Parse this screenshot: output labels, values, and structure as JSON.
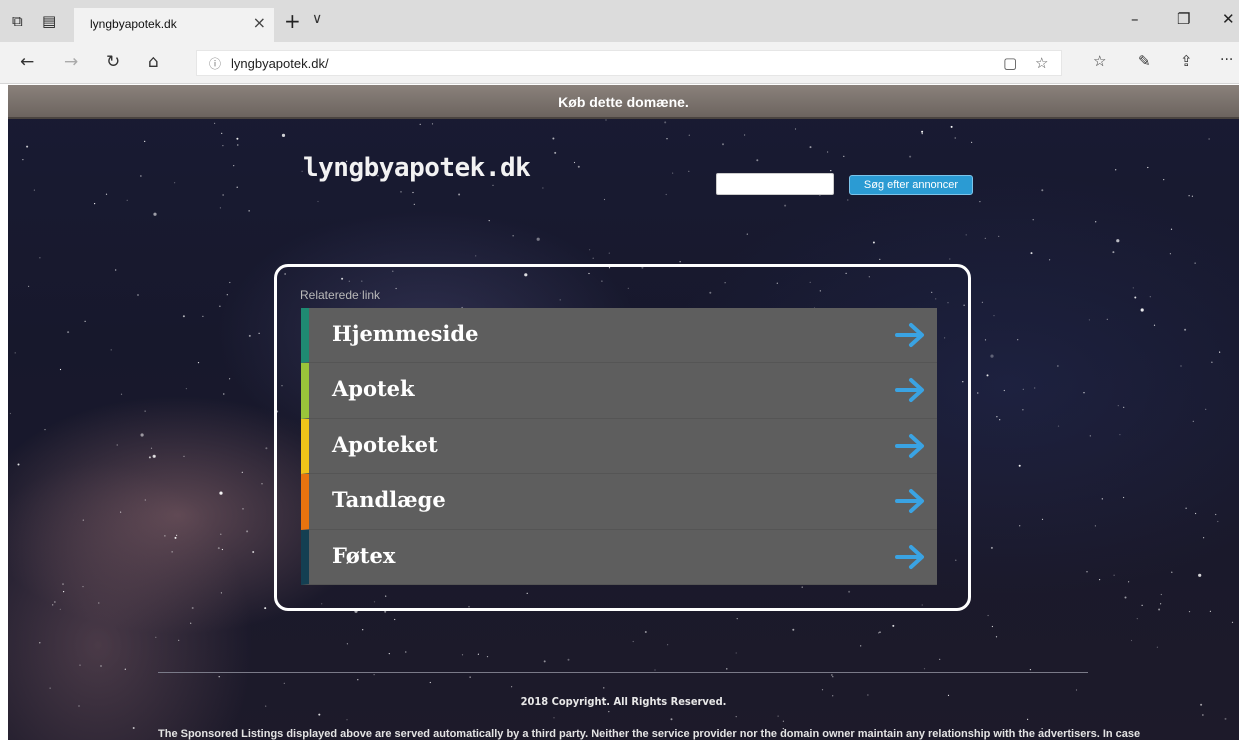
{
  "browser": {
    "tab_title": "lyngbyapotek.dk",
    "tab_close": "×",
    "new_tab": "+",
    "tab_menu": "∨",
    "url": "lyngbyapotek.dk/",
    "window_controls": {
      "minimize": "–",
      "restore": "❐",
      "close": "✕"
    },
    "nav": {
      "back": "←",
      "forward": "→",
      "refresh": "↻",
      "home": "⌂"
    },
    "address_icons": {
      "reading_view": "▢",
      "favorite": "☆"
    },
    "toolbar_icons": {
      "favorites": "☆",
      "notes": "✎",
      "share": "⇪",
      "more": "···"
    },
    "icons": {
      "info": "info-icon",
      "set_aside": "tabs-aside-icon",
      "show_tabs": "tab-preview-icon"
    }
  },
  "page": {
    "buy_banner": "Køb dette domæne.",
    "site_name": "lyngbyapotek.dk",
    "search": {
      "value": "",
      "button_label": "Søg efter annoncer"
    },
    "related_label": "Relaterede link",
    "links": [
      {
        "label": "Hjemmeside",
        "color": "#1f8a72"
      },
      {
        "label": "Apotek",
        "color": "#9ac43a"
      },
      {
        "label": "Apoteket",
        "color": "#f0c419"
      },
      {
        "label": "Tandlæge",
        "color": "#e8730f"
      },
      {
        "label": "Føtex",
        "color": "#143f52"
      }
    ],
    "arrow_color": "#3aa3e3",
    "copyright": "2018 Copyright. All Rights Reserved.",
    "disclaimer": "The Sponsored Listings displayed above are served automatically by a third party. Neither the service provider nor the domain owner maintain any relationship with the advertisers. In case"
  }
}
